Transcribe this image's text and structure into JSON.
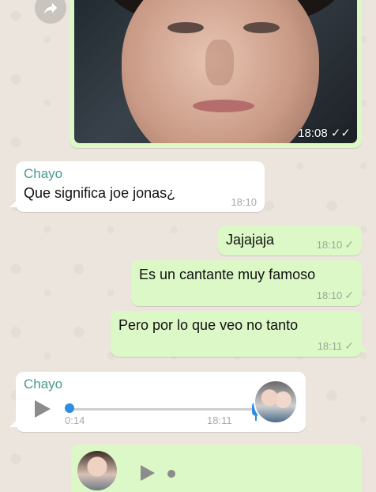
{
  "photo_message": {
    "time": "18:08",
    "status": "✓✓"
  },
  "messages": [
    {
      "sender": "Chayo",
      "text": "Que significa joe jonas¿",
      "time": "18:10"
    },
    {
      "text": "Jajajaja",
      "time": "18:10",
      "status": "✓"
    },
    {
      "text": "Es un cantante muy famoso",
      "time": "18:10",
      "status": "✓"
    },
    {
      "text": "Pero por lo que veo no tanto",
      "time": "18:11",
      "status": "✓"
    }
  ],
  "voice_message": {
    "sender": "Chayo",
    "duration": "0:14",
    "time": "18:11"
  },
  "colors": {
    "outgoing": "#dcf8c6",
    "incoming": "#ffffff",
    "sender_name": "#4a9b8e",
    "accent": "#2e8de0",
    "wallpaper": "#ece5dd"
  }
}
